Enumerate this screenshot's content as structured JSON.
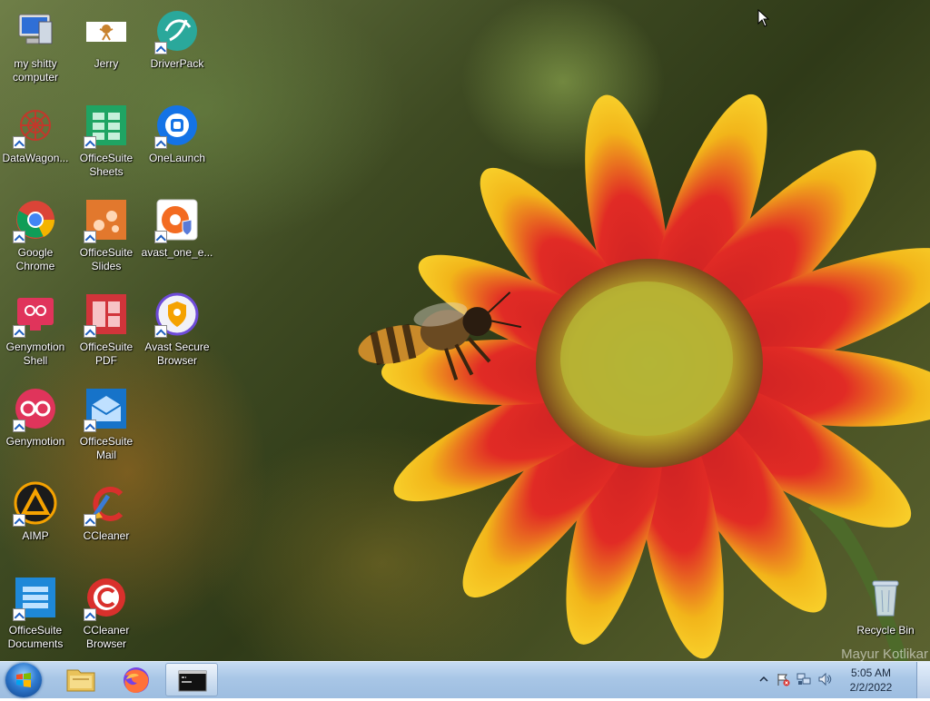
{
  "desktop": {
    "icons": [
      {
        "label": "my shitty computer",
        "icon": "computer-icon"
      },
      {
        "label": "DataWagon...",
        "icon": "datawagon-icon"
      },
      {
        "label": "Google Chrome",
        "icon": "chrome-icon"
      },
      {
        "label": "Genymotion Shell",
        "icon": "genymotion-shell-icon"
      },
      {
        "label": "Genymotion",
        "icon": "genymotion-icon"
      },
      {
        "label": "AIMP",
        "icon": "aimp-icon"
      },
      {
        "label": "OfficeSuite Documents",
        "icon": "officesuite-documents-icon"
      },
      {
        "label": "Jerry",
        "icon": "jerry-icon"
      },
      {
        "label": "OfficeSuite Sheets",
        "icon": "officesuite-sheets-icon"
      },
      {
        "label": "OfficeSuite Slides",
        "icon": "officesuite-slides-icon"
      },
      {
        "label": "OfficeSuite PDF",
        "icon": "officesuite-pdf-icon"
      },
      {
        "label": "OfficeSuite Mail",
        "icon": "officesuite-mail-icon"
      },
      {
        "label": "CCleaner",
        "icon": "ccleaner-icon"
      },
      {
        "label": "CCleaner Browser",
        "icon": "ccleaner-browser-icon"
      },
      {
        "label": "DriverPack",
        "icon": "driverpack-icon"
      },
      {
        "label": "OneLaunch",
        "icon": "onelaunch-icon"
      },
      {
        "label": "avast_one_e...",
        "icon": "avast-one-icon"
      },
      {
        "label": "Avast Secure Browser",
        "icon": "avast-secure-browser-icon"
      },
      {
        "label": "Recycle Bin",
        "icon": "recycle-bin-icon"
      }
    ],
    "watermark": "Mayur Kotlikar"
  },
  "taskbar": {
    "pinned": [
      {
        "name": "file-explorer",
        "icon": "folder-icon"
      },
      {
        "name": "firefox",
        "icon": "firefox-icon"
      },
      {
        "name": "command-prompt",
        "icon": "cmd-icon"
      }
    ],
    "tray_icons": [
      "show-hidden-icons-icon",
      "action-center-flag-icon",
      "network-icon",
      "volume-icon"
    ],
    "clock": {
      "time": "5:05 AM",
      "date": "2/2/2022"
    }
  },
  "colors": {
    "taskbar": "#a8c6e6",
    "petal_red": "#d8232a",
    "petal_yellow": "#f5c517"
  }
}
